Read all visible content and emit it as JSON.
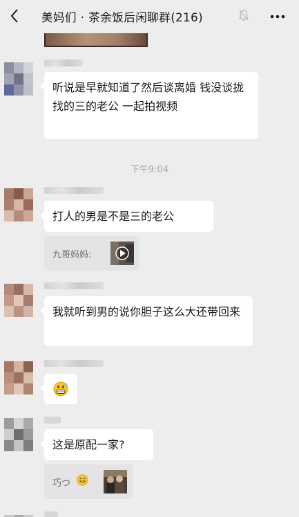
{
  "header": {
    "title": "美妈们 · 茶余饭后闲聊群",
    "member_count": "(216)",
    "back_icon": "chevron-left-icon",
    "mute_icon": "muted-bell-icon",
    "more_icon": "more-dots-icon"
  },
  "timestamp": "下午9:04",
  "messages": [
    {
      "text": "听说是早就知道了然后谈离婚 钱没谈拢 找的三的老公 一起拍视频"
    },
    {
      "text": "打人的男是不是三的老公",
      "quote": {
        "name": "九哥妈妈:"
      }
    },
    {
      "text": "我就听到男的说你胆子这么大还带回来"
    },
    {
      "emoji": "grimace-emoji"
    },
    {
      "text": "这是原配一家?",
      "quote": {
        "name": "巧つ",
        "emoji": "sweat-smile-emoji"
      }
    }
  ]
}
